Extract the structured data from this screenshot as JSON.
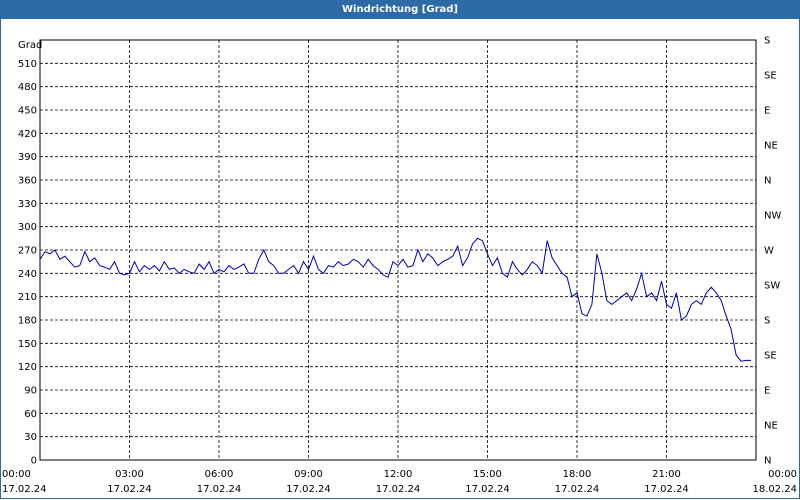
{
  "window": {
    "title": "Windrichtung [Grad]"
  },
  "chart_data": {
    "type": "line",
    "title": "Windrichtung [Grad]",
    "ylabel": "Grad",
    "ylim": [
      0,
      540
    ],
    "yticks": [
      0,
      30,
      60,
      90,
      120,
      150,
      180,
      210,
      240,
      270,
      300,
      330,
      360,
      390,
      420,
      450,
      480,
      510
    ],
    "xlim": [
      "2024-02-17T00:00",
      "2024-02-18T00:00"
    ],
    "xticks": [
      {
        "time": "00:00",
        "date": "17.02.24"
      },
      {
        "time": "03:00",
        "date": "17.02.24"
      },
      {
        "time": "06:00",
        "date": "17.02.24"
      },
      {
        "time": "09:00",
        "date": "17.02.24"
      },
      {
        "time": "12:00",
        "date": "17.02.24"
      },
      {
        "time": "15:00",
        "date": "17.02.24"
      },
      {
        "time": "18:00",
        "date": "17.02.24"
      },
      {
        "time": "21:00",
        "date": "17.02.24"
      },
      {
        "time": "00:00",
        "date": "18.02.24"
      }
    ],
    "right_axis_labels": [
      "N",
      "NE",
      "E",
      "SE",
      "S",
      "SW",
      "W",
      "NW",
      "N",
      "NE",
      "E",
      "SE",
      "S"
    ],
    "right_axis_values": [
      0,
      45,
      90,
      135,
      180,
      225,
      270,
      315,
      360,
      405,
      450,
      495,
      540
    ],
    "grid": true,
    "line_color": "#0000aa",
    "series": [
      {
        "x": [
          "2024-02-17T00:00",
          "2024-02-17T00:10",
          "2024-02-17T00:20",
          "2024-02-17T00:30",
          "2024-02-17T00:40",
          "2024-02-17T00:50",
          "2024-02-17T01:00",
          "2024-02-17T01:10",
          "2024-02-17T01:20",
          "2024-02-17T01:30",
          "2024-02-17T01:40",
          "2024-02-17T01:50",
          "2024-02-17T02:00",
          "2024-02-17T02:10",
          "2024-02-17T02:20",
          "2024-02-17T02:30",
          "2024-02-17T02:40",
          "2024-02-17T02:50",
          "2024-02-17T03:00",
          "2024-02-17T03:10",
          "2024-02-17T03:20",
          "2024-02-17T03:30",
          "2024-02-17T03:40",
          "2024-02-17T03:50",
          "2024-02-17T04:00",
          "2024-02-17T04:10",
          "2024-02-17T04:20",
          "2024-02-17T04:30",
          "2024-02-17T04:40",
          "2024-02-17T04:50",
          "2024-02-17T05:00",
          "2024-02-17T05:10",
          "2024-02-17T05:20",
          "2024-02-17T05:30",
          "2024-02-17T05:40",
          "2024-02-17T05:50",
          "2024-02-17T06:00",
          "2024-02-17T06:10",
          "2024-02-17T06:20",
          "2024-02-17T06:30",
          "2024-02-17T06:40",
          "2024-02-17T06:50",
          "2024-02-17T07:00",
          "2024-02-17T07:10",
          "2024-02-17T07:20",
          "2024-02-17T07:30",
          "2024-02-17T07:40",
          "2024-02-17T07:50",
          "2024-02-17T08:00",
          "2024-02-17T08:10",
          "2024-02-17T08:20",
          "2024-02-17T08:30",
          "2024-02-17T08:40",
          "2024-02-17T08:50",
          "2024-02-17T09:00",
          "2024-02-17T09:10",
          "2024-02-17T09:20",
          "2024-02-17T09:30",
          "2024-02-17T09:40",
          "2024-02-17T09:50",
          "2024-02-17T10:00",
          "2024-02-17T10:10",
          "2024-02-17T10:20",
          "2024-02-17T10:30",
          "2024-02-17T10:40",
          "2024-02-17T10:50",
          "2024-02-17T11:00",
          "2024-02-17T11:10",
          "2024-02-17T11:20",
          "2024-02-17T11:30",
          "2024-02-17T11:40",
          "2024-02-17T11:50",
          "2024-02-17T12:00",
          "2024-02-17T12:10",
          "2024-02-17T12:20",
          "2024-02-17T12:30",
          "2024-02-17T12:40",
          "2024-02-17T12:50",
          "2024-02-17T13:00",
          "2024-02-17T13:10",
          "2024-02-17T13:20",
          "2024-02-17T13:30",
          "2024-02-17T13:40",
          "2024-02-17T13:50",
          "2024-02-17T14:00",
          "2024-02-17T14:10",
          "2024-02-17T14:20",
          "2024-02-17T14:30",
          "2024-02-17T14:40",
          "2024-02-17T14:50",
          "2024-02-17T15:00",
          "2024-02-17T15:10",
          "2024-02-17T15:20",
          "2024-02-17T15:30",
          "2024-02-17T15:40",
          "2024-02-17T15:50",
          "2024-02-17T16:00",
          "2024-02-17T16:10",
          "2024-02-17T16:20",
          "2024-02-17T16:30",
          "2024-02-17T16:40",
          "2024-02-17T16:50",
          "2024-02-17T17:00",
          "2024-02-17T17:10",
          "2024-02-17T17:20",
          "2024-02-17T17:30",
          "2024-02-17T17:40",
          "2024-02-17T17:50",
          "2024-02-17T18:00",
          "2024-02-17T18:10",
          "2024-02-17T18:20",
          "2024-02-17T18:30",
          "2024-02-17T18:40",
          "2024-02-17T18:50",
          "2024-02-17T19:00",
          "2024-02-17T19:10",
          "2024-02-17T19:20",
          "2024-02-17T19:30",
          "2024-02-17T19:40",
          "2024-02-17T19:50",
          "2024-02-17T20:00",
          "2024-02-17T20:10",
          "2024-02-17T20:20",
          "2024-02-17T20:30",
          "2024-02-17T20:40",
          "2024-02-17T20:50",
          "2024-02-17T21:00",
          "2024-02-17T21:10",
          "2024-02-17T21:20",
          "2024-02-17T21:30",
          "2024-02-17T21:40",
          "2024-02-17T21:50",
          "2024-02-17T22:00",
          "2024-02-17T22:10",
          "2024-02-17T22:20",
          "2024-02-17T22:30",
          "2024-02-17T22:40",
          "2024-02-17T22:50",
          "2024-02-17T23:00",
          "2024-02-17T23:10",
          "2024-02-17T23:20",
          "2024-02-17T23:30",
          "2024-02-17T23:40",
          "2024-02-17T23:50"
        ],
        "values": [
          258,
          268,
          265,
          270,
          258,
          262,
          255,
          248,
          250,
          268,
          255,
          260,
          250,
          248,
          245,
          255,
          240,
          238,
          240,
          255,
          242,
          250,
          245,
          250,
          243,
          255,
          245,
          247,
          240,
          245,
          242,
          240,
          252,
          245,
          255,
          240,
          245,
          242,
          250,
          245,
          248,
          252,
          240,
          240,
          258,
          270,
          255,
          250,
          240,
          240,
          245,
          250,
          240,
          255,
          245,
          262,
          245,
          240,
          250,
          248,
          255,
          250,
          252,
          258,
          255,
          248,
          258,
          250,
          245,
          238,
          235,
          255,
          250,
          258,
          248,
          250,
          270,
          255,
          265,
          260,
          250,
          255,
          258,
          262,
          275,
          250,
          260,
          278,
          285,
          282,
          265,
          250,
          260,
          240,
          235,
          255,
          245,
          238,
          245,
          255,
          250,
          240,
          282,
          260,
          250,
          240,
          235,
          210,
          215,
          188,
          185,
          200,
          265,
          240,
          205,
          200,
          205,
          210,
          215,
          205,
          220,
          240,
          210,
          215,
          205,
          230,
          200,
          195,
          215,
          180,
          185,
          200,
          205,
          200,
          215,
          222,
          215,
          205,
          185,
          168,
          135,
          127,
          128,
          128
        ]
      }
    ]
  }
}
